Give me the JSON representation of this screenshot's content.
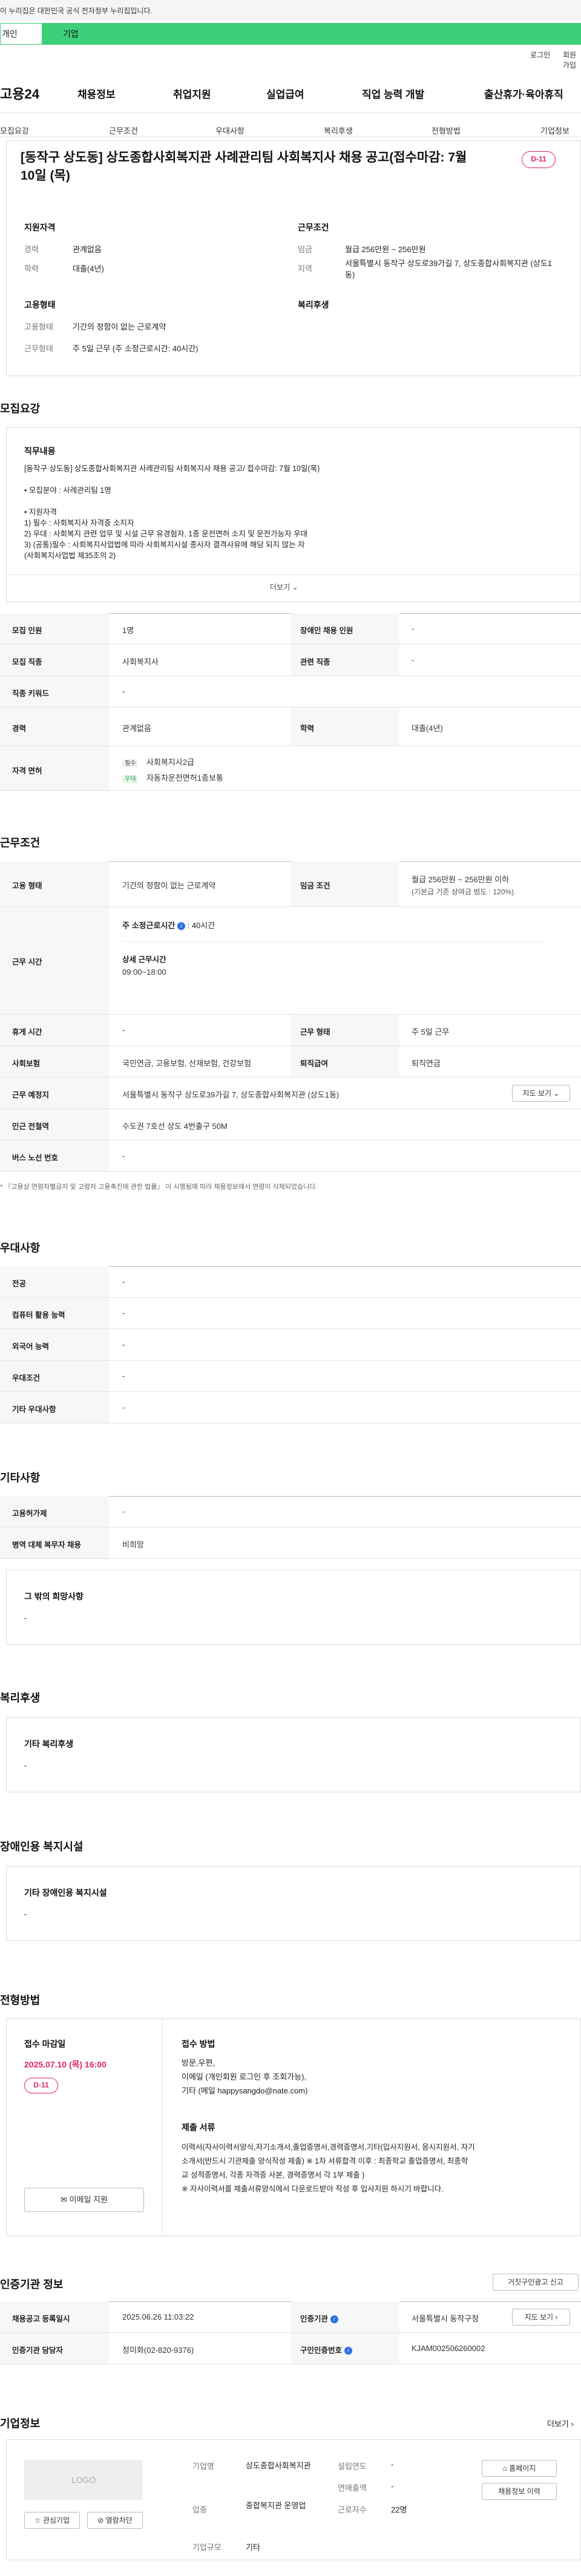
{
  "gov_notice": "이 누리집은 대한민국 공식 전자정부 누리집입니다.",
  "tabs": {
    "a": "개인",
    "b": "기업"
  },
  "util": {
    "login": "로그인",
    "join": "회원가입"
  },
  "logo": "고용24",
  "gnb": [
    "채용정보",
    "취업지원",
    "실업급여",
    "직업 능력 개발",
    "출산휴가·육아휴직"
  ],
  "anchors": [
    "모집요강",
    "근무조건",
    "우대사항",
    "복리후생",
    "전형방법",
    "기업정보"
  ],
  "header": {
    "title": "[동작구 상도동] 상도종합사회복지관 사례관리팀 사회복지사 채용 공고(접수마감: 7월 10일 (목)",
    "dday": "D-11",
    "qual_title": "지원자격",
    "qual": [
      {
        "k": "경력",
        "v": "관계없음"
      },
      {
        "k": "학력",
        "v": "대졸(4년)"
      }
    ],
    "cond_title": "근무조건",
    "cond": [
      {
        "k": "임금",
        "v": "월급 256만원 ~ 256만원"
      },
      {
        "k": "지역",
        "v": "서울특별시 동작구 상도로39가길 7, 상도종합사회복지관 (상도1동)"
      }
    ],
    "emp_title": "고용형태",
    "emp": [
      {
        "k": "고용형태",
        "v": "기간의 정함이 없는 근로계약"
      },
      {
        "k": "근무형태",
        "v": "주 5일 근무 (주 소정근로시간: 40시간)"
      }
    ],
    "welfare_title": "복리후생"
  },
  "recruit": {
    "title": "모집요강",
    "duty_title": "직무내용",
    "duty_text": [
      "[동작구 상도동] 상도종합사회복지관 사례관리팀 사회복지사 채용 공고/ 접수마감: 7월 10일(목)",
      "",
      "• 모집분야 : 사례관리팀 1명",
      "",
      "• 지원자격",
      "1) 필수 : 사회복지사 자격증 소지자",
      "2) 우대 : 사회복지 관련 업무 및 시설 근무 유경험자, 1종 운전면허 소지 및 운전가능자 우대",
      "3) (공통)필수 : 사회복지사업법에 따라 사회복지시설 종사자 결격사유에 해당 되지 않는 자",
      "(사회복지사업법 제35조의 2)"
    ],
    "more": "더보기",
    "rows": [
      [
        {
          "k": "모집 인원",
          "v": "1명"
        },
        {
          "k": "장애인 채용 인원",
          "v": "-"
        }
      ],
      [
        {
          "k": "모집 직종",
          "v": "사회복지사"
        },
        {
          "k": "관련 직종",
          "v": "-"
        }
      ],
      [
        {
          "k": "직종 키워드",
          "v": "-"
        }
      ],
      [
        {
          "k": "경력",
          "v": "관계없음"
        },
        {
          "k": "학력",
          "v": "대졸(4년)"
        }
      ]
    ],
    "license_key": "자격 면허",
    "licenses": [
      {
        "tag": "필수",
        "name": "사회복지사2급"
      },
      {
        "tag": "우대",
        "name": "자동차운전면허1종보통"
      }
    ]
  },
  "work": {
    "title": "근무조건",
    "emp_k": "고용 형태",
    "emp_v": "기간의 정함이 없는 근로계약",
    "wage_k": "임금 조건",
    "wage_v": "월급 256만원 ~ 256만원 이하",
    "wage_note": "(기본급 기준 상여금 범도 : 120%)",
    "time_k": "근무 시간",
    "time_week": "주 소정근로시간",
    "time_week_v": ": 40시간",
    "time_detail_k": "상세 근무시간",
    "time_detail_v": "09:00~18:00",
    "rest_k": "휴게 시간",
    "rest_v": "-",
    "form_k": "근무 형태",
    "form_v": "주 5일 근무",
    "ins_k": "사회보험",
    "ins_v": "국민연금, 고용보험, 산재보험, 건강보험",
    "ret_k": "퇴직급여",
    "ret_v": "퇴직연금",
    "place_k": "근무 예정지",
    "place_v": "서울특별시 동작구 상도로39가길 7, 상도종합사회복지관 (상도1동)",
    "map_btn": "지도 보기",
    "subway_k": "인근 전철역",
    "subway_v": "수도권 7호선 상도 4번출구 50M",
    "bus_k": "버스 노선 번호",
    "bus_v": "-",
    "note": "* 『고용상 연령차별금지 및 고령자 고용촉진에 관한 법률』 이 시행됨에 따라 채용정보에서 연령이 삭제되었습니다."
  },
  "pref": {
    "title": "우대사항",
    "rows": [
      {
        "k": "전공",
        "v": "-"
      },
      {
        "k": "컴퓨터 활용 능력",
        "v": "-"
      },
      {
        "k": "외국어 능력",
        "v": "-"
      },
      {
        "k": "우대조건",
        "v": "-"
      },
      {
        "k": "기타 우대사항",
        "v": "-"
      }
    ]
  },
  "etc": {
    "title": "기타사항",
    "rows": [
      {
        "k": "고용허가제",
        "v": "-"
      },
      {
        "k": "병역 대체 복무자 채용",
        "v": "비희망"
      }
    ],
    "other_title": "그 밖의 희망사항",
    "other_v": "-"
  },
  "welfare": {
    "title": "복리후생",
    "sub": "기타 복리후생",
    "v": "-"
  },
  "disabled": {
    "title": "장애인용 복지시설",
    "sub": "기타 장애인용 복지시설",
    "v": "-"
  },
  "selection": {
    "title": "전형방법",
    "deadline_k": "접수 마감일",
    "deadline_v": "2025.07.10 (목) 16:00",
    "dday": "D-11",
    "method_k": "접수 방법",
    "method_lines": [
      "방문,우편,",
      "이메일 (개인회원 로그인 후 조회가능),",
      "기타 (메일 happysangdo@nate.com)"
    ],
    "docs_k": "제출 서류",
    "docs_lines": [
      "이력서(자사이력서양식,자기소개서,졸업증명서,경력증명서,기타(입사지원서, 응시지원서, 자기",
      "소개서(반드시 기관제출 양식작성 제출) ※ 1차 서류합격 이후 : 최종학교 졸업증명서, 최종학",
      "교 성적증명서, 각종 자격증 사본, 경력증명서 각 1부 제출 )",
      "※ 자사이력서를 제출서류양식에서 다운로드받아 작성 후 입사지원 하시기 바랍니다."
    ],
    "email_btn": "이메일 지원"
  },
  "cert": {
    "title": "인증기관 정보",
    "report_btn": "거짓구인광고 신고",
    "reg_k": "채용공고 등록일시",
    "reg_v": "2025.06.26 11:03:22",
    "org_k": "인증기관",
    "org_v": "서울특별시 동작구청",
    "map_btn": "지도 보기",
    "staff_k": "인증기관 담당자",
    "staff_v": "정미화(02-820-9376)",
    "no_k": "구인인증번호",
    "no_v": "KJAM002506260002"
  },
  "company": {
    "title": "기업정보",
    "more": "더보기",
    "logo": "LOGO",
    "fav_btn": "관심기업",
    "block_btn": "열람차단",
    "name_k": "기업명",
    "name_v": "상도종합사회복지관",
    "est_k": "설립연도",
    "est_v": "-",
    "ind_k": "업종",
    "ind_v": "종합복지관 운영업",
    "sales_k": "연매출액",
    "sales_v": "-",
    "emp_k": "근로자수",
    "emp_v": "22명",
    "size_k": "기업규모",
    "size_v": "기타",
    "home_btn": "홈페이지",
    "jobs_btn": "채용정보 이력"
  },
  "icons": [
    "chevron-down-icon",
    "mail-icon",
    "star-icon",
    "home-icon",
    "chevron-right-icon",
    "info-icon"
  ]
}
